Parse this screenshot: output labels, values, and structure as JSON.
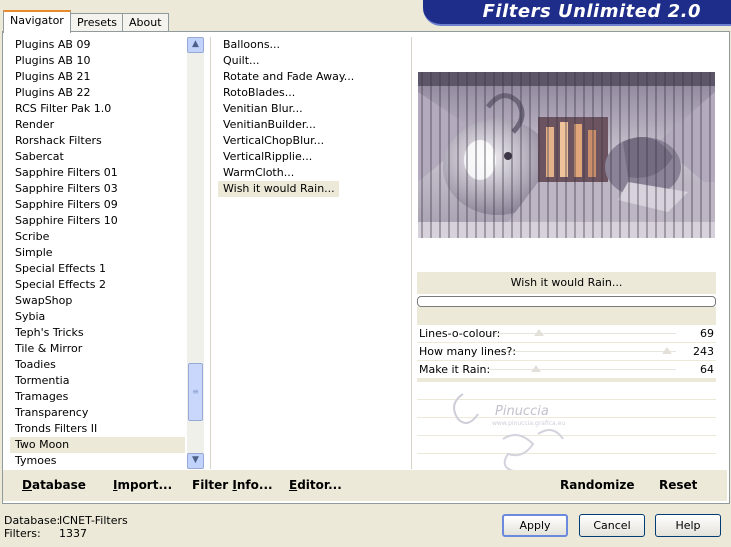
{
  "banner": {
    "title": "Filters Unlimited 2.0"
  },
  "tabs": [
    {
      "label": "Navigator",
      "active": true
    },
    {
      "label": "Presets",
      "active": false
    },
    {
      "label": "About",
      "active": false
    }
  ],
  "categories": [
    "Plugins AB 09",
    "Plugins AB 10",
    "Plugins AB 21",
    "Plugins AB 22",
    "RCS Filter Pak 1.0",
    "Render",
    "Rorshack Filters",
    "Sabercat",
    "Sapphire Filters 01",
    "Sapphire Filters 03",
    "Sapphire Filters 09",
    "Sapphire Filters 10",
    "Scribe",
    "Simple",
    "Special Effects 1",
    "Special Effects 2",
    "SwapShop",
    "Sybia",
    "Teph's Tricks",
    "Tile & Mirror",
    "Toadies",
    "Tormentia",
    "Tramages",
    "Transparency",
    "Tronds Filters II",
    "Two Moon",
    "Tymoes"
  ],
  "selected_category": "Two Moon",
  "filters": [
    "Balloons...",
    "Quilt...",
    "Rotate and Fade Away...",
    "RotoBlades...",
    "Venitian Blur...",
    "VenitianBuilder...",
    "VerticalChopBlur...",
    "VerticalRipplie...",
    "WarmCloth...",
    "Wish it would Rain..."
  ],
  "selected_filter": "Wish it would Rain...",
  "preview": {
    "filter_name": "Wish it would Rain..."
  },
  "params": [
    {
      "label": "Lines-o-colour:",
      "value": "69",
      "level": 0.27
    },
    {
      "label": "How many lines?:",
      "value": "243",
      "level": 0.95
    },
    {
      "label": "Make it Rain:",
      "value": "64",
      "level": 0.25
    }
  ],
  "bottom_buttons": {
    "database": "atabase",
    "database_u": "D",
    "import": "mport...",
    "import_u": "I",
    "filter_info_a": "Filter ",
    "filter_info_u": "I",
    "filter_info_b": "nfo...",
    "editor_u": "E",
    "editor": "ditor...",
    "randomize": "Randomize",
    "reset": "Reset"
  },
  "status": {
    "database_label": "Database:",
    "database_value": "ICNET-Filters",
    "filters_label": "Filters:",
    "filters_value": "1337"
  },
  "dialog_buttons": {
    "apply": "Apply",
    "cancel": "Cancel",
    "help": "Help"
  },
  "watermark": {
    "text": "Pinuccia",
    "url": "www.pinuccia.grafica.eu"
  }
}
